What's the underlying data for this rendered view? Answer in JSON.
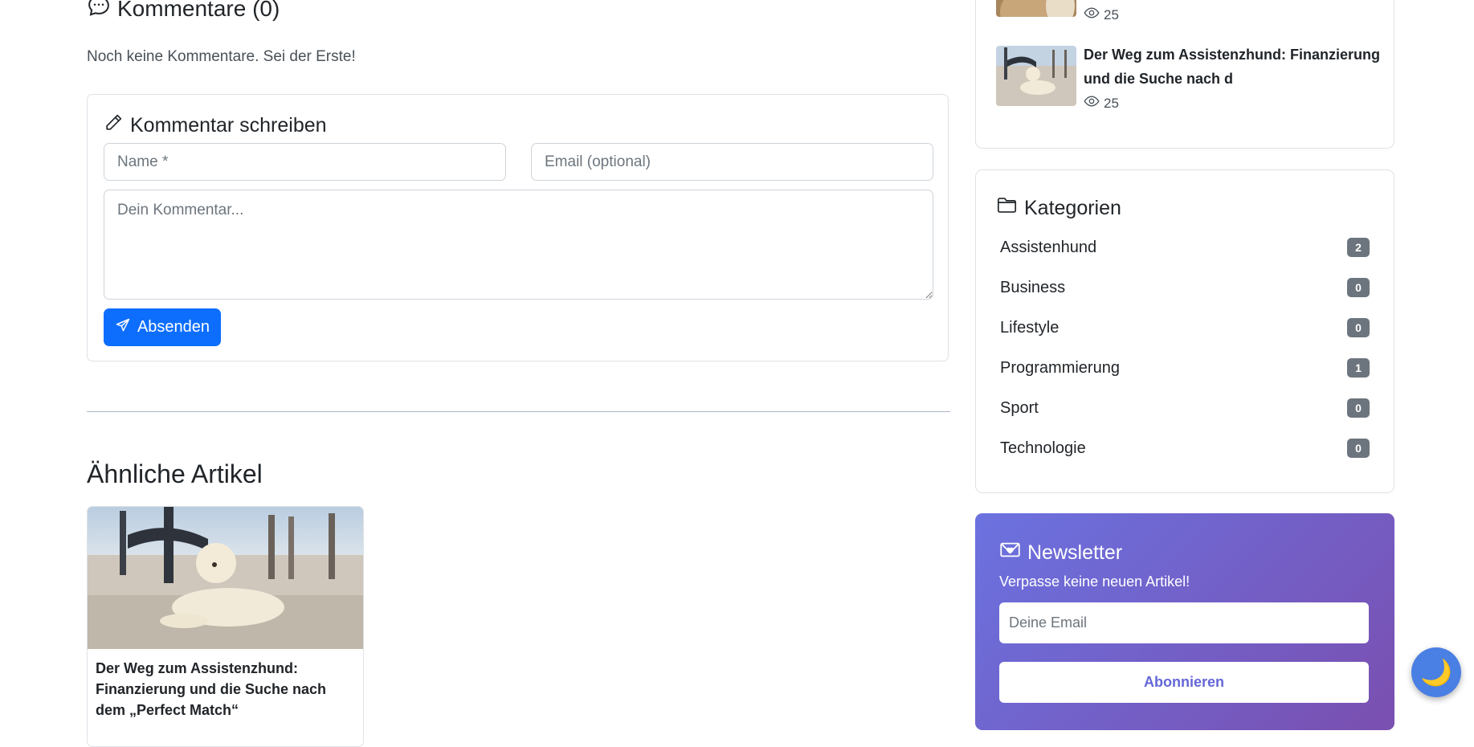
{
  "comments": {
    "title": "Kommentare (0)",
    "empty_text": "Noch keine Kommentare. Sei der Erste!",
    "form": {
      "title": "Kommentar schreiben",
      "name_placeholder": "Name *",
      "email_placeholder": "Email (optional)",
      "comment_placeholder": "Dein Kommentar...",
      "submit_label": "Absenden"
    }
  },
  "related": {
    "title": "Ähnliche Artikel",
    "articles": [
      {
        "title": "Der Weg zum Assistenzhund: Finanzierung und die Suche nach dem „Perfect Match“"
      }
    ]
  },
  "sidebar": {
    "popular": {
      "items": [
        {
          "title": "",
          "views": "25"
        },
        {
          "title": "Der Weg zum Assistenzhund: Finanzierung und die Suche nach d",
          "views": "25"
        }
      ]
    },
    "categories": {
      "title": "Kategorien",
      "items": [
        {
          "name": "Assistenhund",
          "count": "2"
        },
        {
          "name": "Business",
          "count": "0"
        },
        {
          "name": "Lifestyle",
          "count": "0"
        },
        {
          "name": "Programmierung",
          "count": "1"
        },
        {
          "name": "Sport",
          "count": "0"
        },
        {
          "name": "Technologie",
          "count": "0"
        }
      ]
    },
    "newsletter": {
      "title": "Newsletter",
      "subtitle": "Verpasse keine neuen Artikel!",
      "email_placeholder": "Deine Email",
      "button_label": "Abonnieren"
    }
  },
  "theme_toggle": {
    "icon": "🌙"
  },
  "colors": {
    "primary": "#0d6efd",
    "badge": "#6c757d",
    "newsletter_start": "#6b72e0",
    "newsletter_end": "#7a4fb0",
    "toggle": "#4a7fe3"
  }
}
